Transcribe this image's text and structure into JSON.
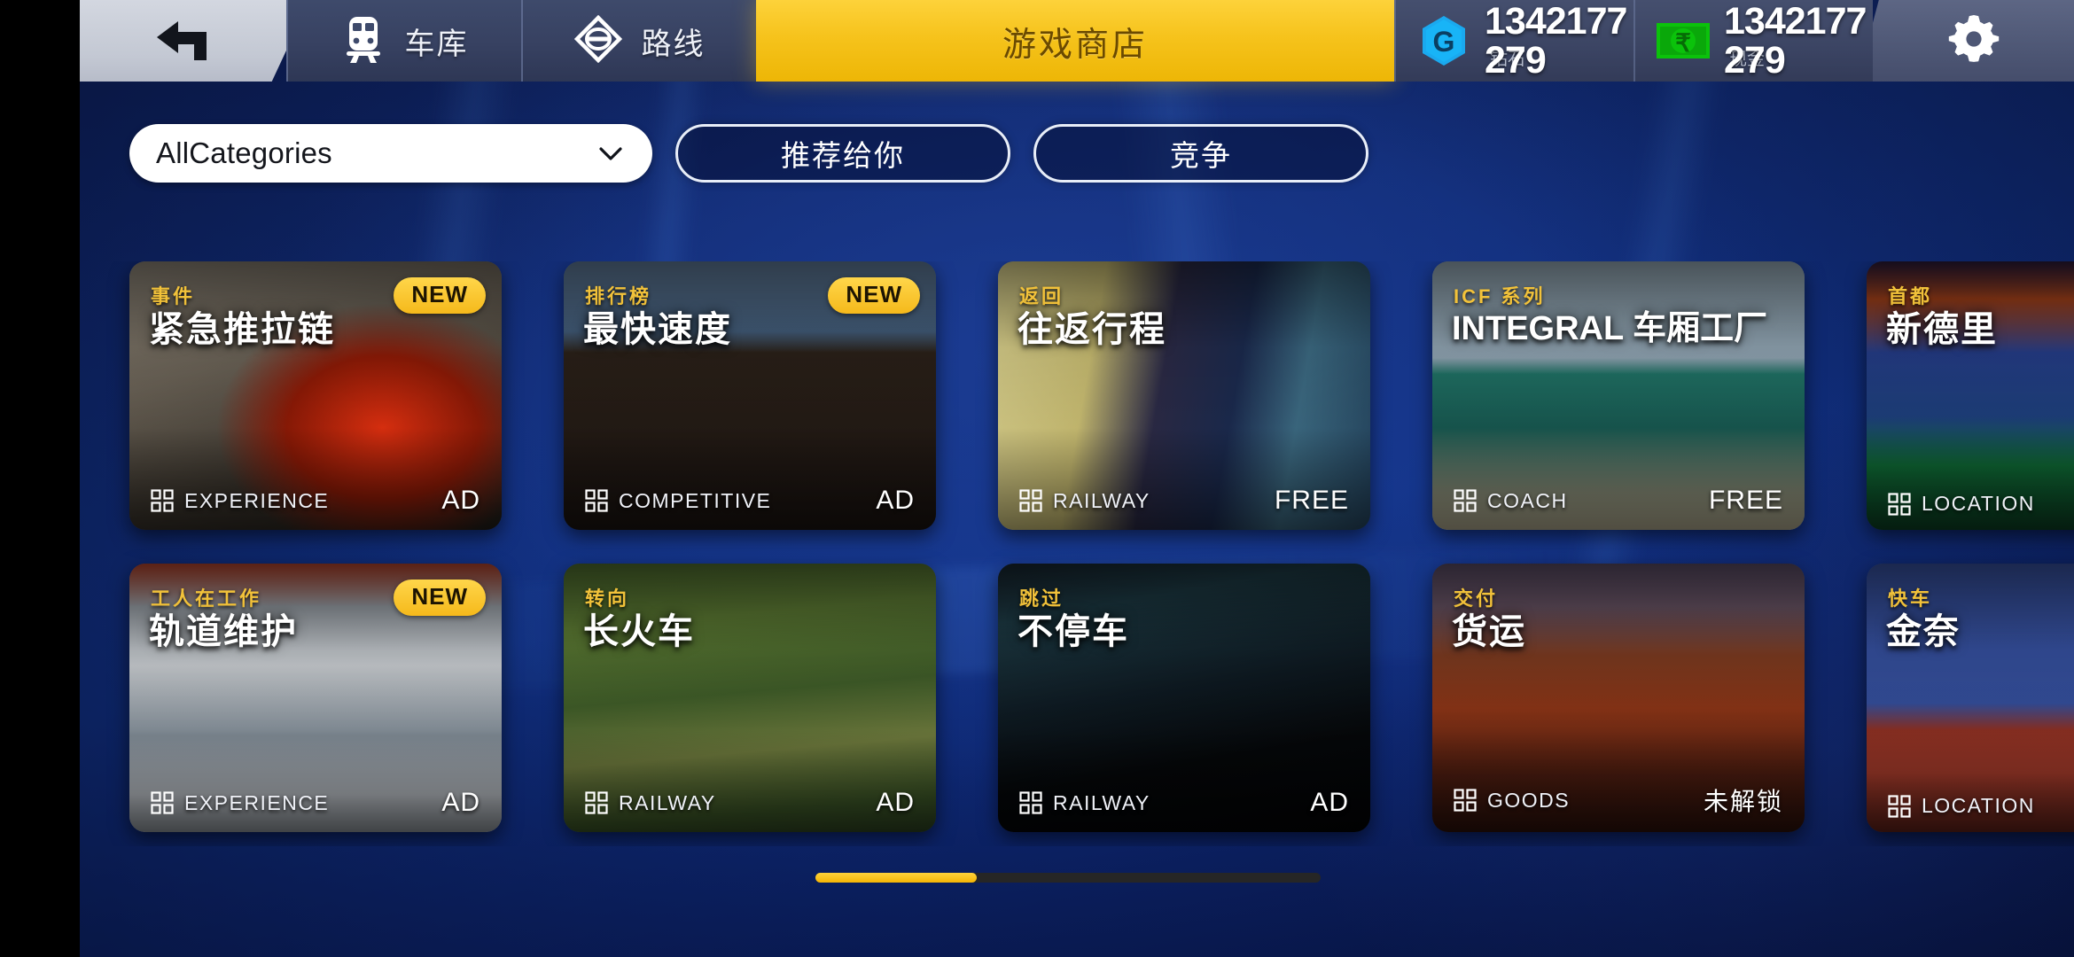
{
  "topbar": {
    "back_icon": "back-arrow-icon",
    "tabs": [
      {
        "label": "车库",
        "icon": "train-front-icon"
      },
      {
        "label": "路线",
        "icon": "route-diamond-icon"
      }
    ],
    "store_tab": {
      "label": "游戏商店"
    },
    "currencies": [
      {
        "icon": "gem-icon",
        "amount": "1342177279",
        "sub": "钻石"
      },
      {
        "icon": "cash-icon",
        "amount": "1342177279",
        "sub": "现金"
      }
    ],
    "settings_icon": "gear-icon"
  },
  "filters": {
    "dropdown": {
      "value": "AllCategories",
      "icon": "chevron-down-icon"
    },
    "buttons": [
      {
        "label": "推荐给你"
      },
      {
        "label": "竞争"
      }
    ]
  },
  "cards": [
    {
      "tag": "事件",
      "title": "紧急推拉链",
      "latin": false,
      "new": true,
      "category": "EXPERIENCE",
      "price": "AD",
      "price_cjk": false
    },
    {
      "tag": "排行榜",
      "title": "最快速度",
      "latin": false,
      "new": true,
      "category": "COMPETITIVE",
      "price": "AD",
      "price_cjk": false
    },
    {
      "tag": "返回",
      "title": "往返行程",
      "latin": false,
      "new": false,
      "category": "RAILWAY",
      "price": "FREE",
      "price_cjk": false
    },
    {
      "tag": "ICF 系列",
      "title": "INTEGRAL 车厢工厂",
      "latin": true,
      "new": false,
      "category": "COACH",
      "price": "FREE",
      "price_cjk": false
    },
    {
      "tag": "首都",
      "title": "新德里",
      "latin": false,
      "new": false,
      "category": "LOCATION",
      "price": "",
      "price_cjk": false
    },
    {
      "tag": "工人在工作",
      "title": "轨道维护",
      "latin": false,
      "new": true,
      "category": "EXPERIENCE",
      "price": "AD",
      "price_cjk": false
    },
    {
      "tag": "转向",
      "title": "长火车",
      "latin": false,
      "new": false,
      "category": "RAILWAY",
      "price": "AD",
      "price_cjk": false
    },
    {
      "tag": "跳过",
      "title": "不停车",
      "latin": false,
      "new": false,
      "category": "RAILWAY",
      "price": "AD",
      "price_cjk": false
    },
    {
      "tag": "交付",
      "title": "货运",
      "latin": false,
      "new": false,
      "category": "GOODS",
      "price": "未解锁",
      "price_cjk": true
    },
    {
      "tag": "快车",
      "title": "金奈",
      "latin": false,
      "new": false,
      "category": "LOCATION",
      "price": "",
      "price_cjk": false
    }
  ],
  "scrollbar": {
    "position_percent": 0,
    "thumb_percent": 32
  },
  "colors": {
    "store_accent": "#f6c31c",
    "tag_yellow": "#f2c23a",
    "card_bg": "#132654",
    "bg_blue": "#113184",
    "scroll_thumb": "#f5b505"
  }
}
